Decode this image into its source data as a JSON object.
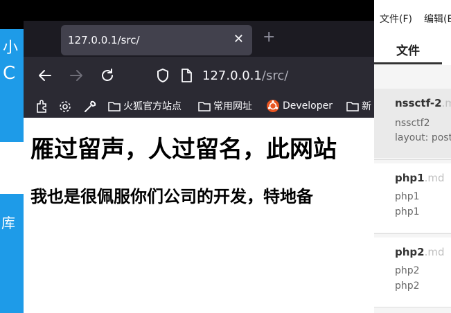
{
  "background_app": {
    "title_fragment": "小",
    "subtitle_fragment": "C",
    "sidebar_fragment": "库"
  },
  "browser": {
    "tab_title": "127.0.0.1/src/",
    "url_host": "127.0.0.1",
    "url_path": "/src/",
    "bookmarks": [
      "火狐官方站点",
      "常用网址",
      "Developer",
      "新"
    ],
    "page_heading": "雁过留声，人过留名，此网站",
    "page_subheading": "我也是很佩服你们公司的开发，特地备"
  },
  "editor": {
    "menu": [
      "文件(F)",
      "编辑(E"
    ],
    "panel_tab": "文件",
    "files": [
      {
        "name": "nssctf-2",
        "ext": ".md",
        "lines": [
          "nssctf2",
          "layout: post"
        ]
      },
      {
        "name": "php1",
        "ext": ".md",
        "lines": [
          "php1",
          "php1"
        ]
      },
      {
        "name": "php2",
        "ext": ".md",
        "lines": [
          "php2",
          "php2"
        ]
      }
    ]
  },
  "colors": {
    "accent_blue": "#1e9be8",
    "browser_chrome": "#2b2a33",
    "tab_active": "#42414d"
  }
}
